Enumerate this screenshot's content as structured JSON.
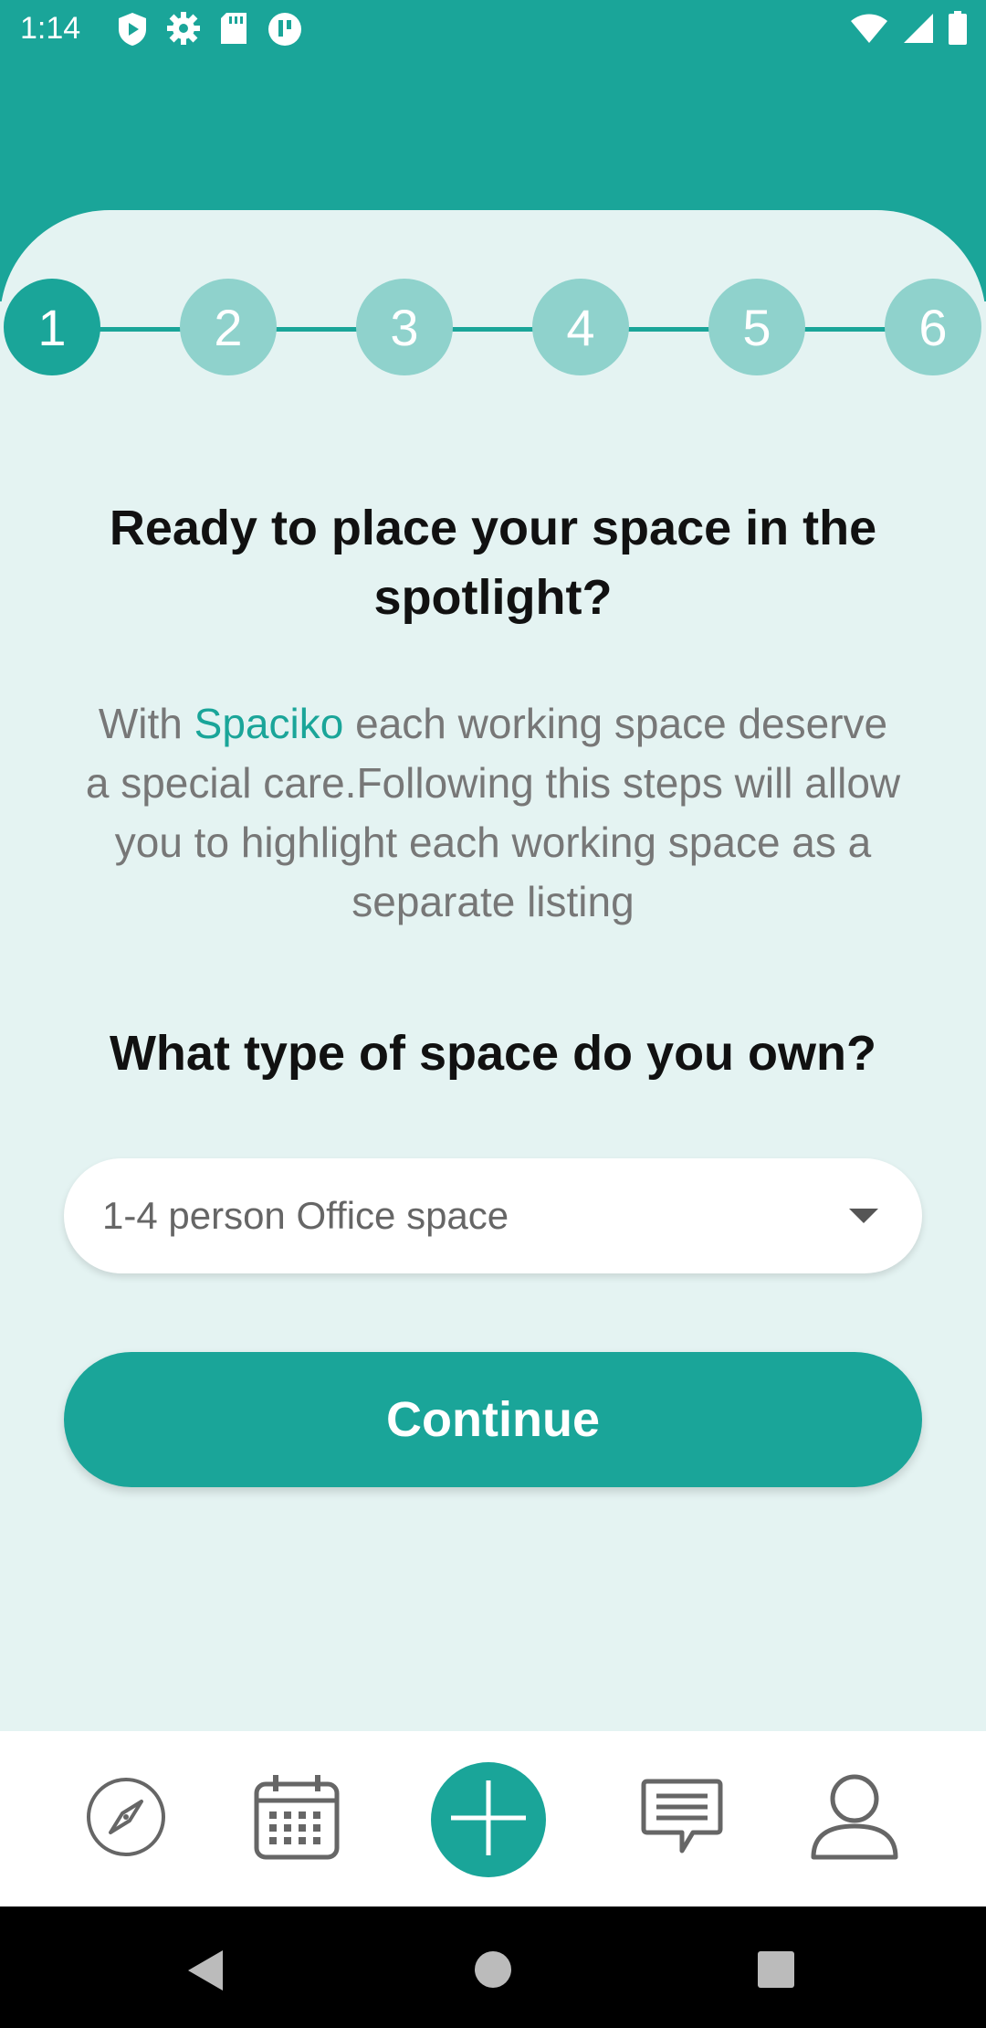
{
  "status_bar": {
    "time": "1:14",
    "icons_left": [
      "play-shield-icon",
      "gear-icon",
      "sd-card-icon",
      "app-badge-icon"
    ],
    "icons_right": [
      "wifi-icon",
      "cell-signal-icon",
      "battery-icon"
    ]
  },
  "stepper": {
    "steps": [
      "1",
      "2",
      "3",
      "4",
      "5",
      "6"
    ],
    "active_step": "1"
  },
  "content": {
    "title": "Ready to place your space in the spotlight?",
    "desc_prefix": "With ",
    "brand": "Spaciko",
    "desc_suffix": " each working space deserve a special care.Following this steps will allow you to highlight each working space as a separate listing",
    "question": "What type of space do you own?"
  },
  "dropdown": {
    "value": "1-4 person Office space"
  },
  "actions": {
    "continue_label": "Continue"
  },
  "bottom_nav": {
    "items": [
      "compass-icon",
      "calendar-icon",
      "add-icon",
      "chat-icon",
      "profile-icon"
    ]
  },
  "colors": {
    "accent": "#1aa599",
    "accent_light": "#8fd2cc",
    "background": "#e4f3f2"
  }
}
